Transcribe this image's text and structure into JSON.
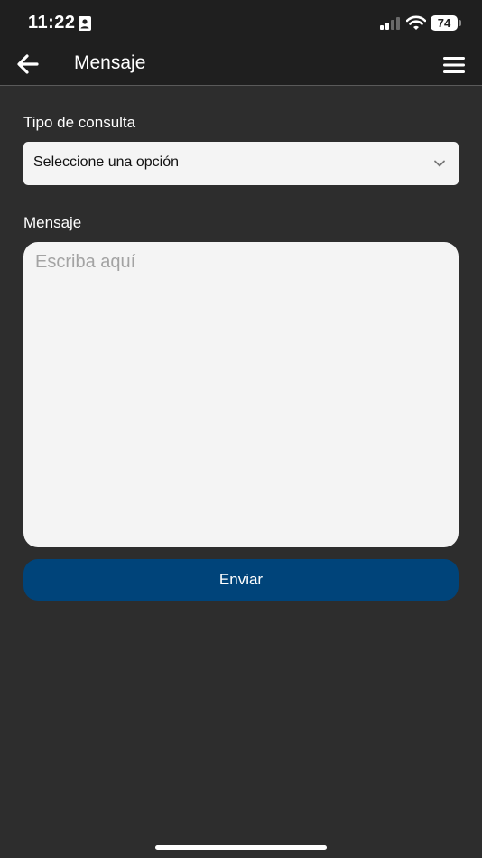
{
  "status_bar": {
    "time": "11:22",
    "battery_level": "74",
    "icons": [
      "contact-card-icon",
      "cellular-signal-icon",
      "wifi-icon",
      "battery-icon"
    ]
  },
  "header": {
    "title": "Mensaje",
    "back_icon": "arrow-left-icon",
    "menu_icon": "hamburger-menu-icon"
  },
  "form": {
    "query_type_label": "Tipo de consulta",
    "query_type_selected": "Seleccione una opción",
    "message_label": "Mensaje",
    "message_value": "",
    "message_placeholder": "Escriba aquí",
    "submit_label": "Enviar"
  },
  "colors": {
    "background": "#2d2d2d",
    "header_background": "#1f1f1f",
    "input_background": "#f4f4f4",
    "primary_button": "#00447a"
  }
}
